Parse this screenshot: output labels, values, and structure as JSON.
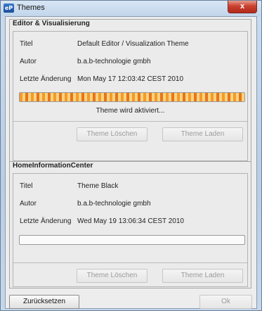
{
  "window": {
    "title": "Themes",
    "icon_text": "eP",
    "close_symbol": "x"
  },
  "sections": [
    {
      "title": "Editor & Visualisierung",
      "fields": [
        {
          "label": "Titel",
          "value": "Default Editor / Visualization Theme"
        },
        {
          "label": "Autor",
          "value": "b.a.b-technologie gmbh"
        },
        {
          "label": "Letzte Änderung",
          "value": "Mon May 17 12:03:42 CEST 2010"
        }
      ],
      "progress": 1.0,
      "status": "Theme wird aktiviert...",
      "delete_label": "Theme Löschen",
      "load_label": "Theme Laden"
    },
    {
      "title": "HomeInformationCenter",
      "fields": [
        {
          "label": "Titel",
          "value": "Theme Black"
        },
        {
          "label": "Autor",
          "value": "b.a.b-technologie gmbh"
        },
        {
          "label": "Letzte Änderung",
          "value": "Wed May 19 13:06:34 CEST 2010"
        }
      ],
      "progress": 0,
      "delete_label": "Theme Löschen",
      "load_label": "Theme Laden"
    }
  ],
  "footer": {
    "reset_label": "Zurücksetzen",
    "ok_label": "Ok"
  }
}
